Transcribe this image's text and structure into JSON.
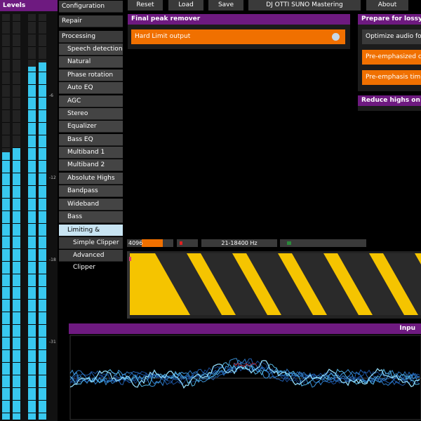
{
  "levels": {
    "title": "Levels",
    "meters": [
      {
        "level": 0.66
      },
      {
        "level": 0.67
      },
      {
        "level": 0.87
      },
      {
        "level": 0.88
      }
    ],
    "scale": [
      "-6",
      "-12",
      "-18",
      "-31"
    ],
    "meter_color": "#38c8ef"
  },
  "menu": {
    "items": [
      {
        "label": "Configuration",
        "level": 0
      },
      {
        "label": "Repair",
        "level": 0
      },
      {
        "label": "Processing",
        "level": 0
      },
      {
        "label": "Speech detection",
        "level": 1
      },
      {
        "label": "Natural Dynamics",
        "level": 1
      },
      {
        "label": "Phase rotation",
        "level": 1
      },
      {
        "label": "Auto EQ",
        "level": 1
      },
      {
        "label": "AGC",
        "level": 1
      },
      {
        "label": "Stereo",
        "level": 1
      },
      {
        "label": "Equalizer",
        "level": 1
      },
      {
        "label": "Bass EQ",
        "level": 1
      },
      {
        "label": "Multiband 1",
        "level": 1
      },
      {
        "label": "Multiband 2",
        "level": 1
      },
      {
        "label": "Absolute Highs",
        "level": 1
      },
      {
        "label": "Bandpass",
        "level": 1
      },
      {
        "label": "Wideband Compr.",
        "level": 1
      },
      {
        "label": "Bass",
        "level": 1
      },
      {
        "label": "Limiting & Clipping",
        "level": 1,
        "active": true
      },
      {
        "label": "Simple Clipper",
        "level": 2
      },
      {
        "label": "Advanced Clipper",
        "level": 2
      }
    ]
  },
  "toolbar": {
    "reset": "Reset",
    "load": "Load",
    "save": "Save",
    "preset": "DJ OTTI SUNO Mastering",
    "about": "About"
  },
  "final_peak": {
    "title": "Final peak remover",
    "hard_limit": "Hard Limit output"
  },
  "lossy": {
    "title": "Prepare for lossy c",
    "optimize": "Optimize audio for lossy",
    "pre_emph_clipping": "Pre-emphasized clipp",
    "pre_emph_time": "Pre-emphasis time"
  },
  "reduce_highs": {
    "title": "Reduce highs on st"
  },
  "status": {
    "buffer": "4096",
    "buffer_fill": 0.45,
    "range": "21-18400 Hz"
  },
  "scope": {
    "title": "Inpu"
  },
  "colors": {
    "purple": "#6e1a80",
    "orange": "#f07000",
    "stripe_yellow": "#f5c400",
    "stripe_dark": "#2a2a2a"
  }
}
